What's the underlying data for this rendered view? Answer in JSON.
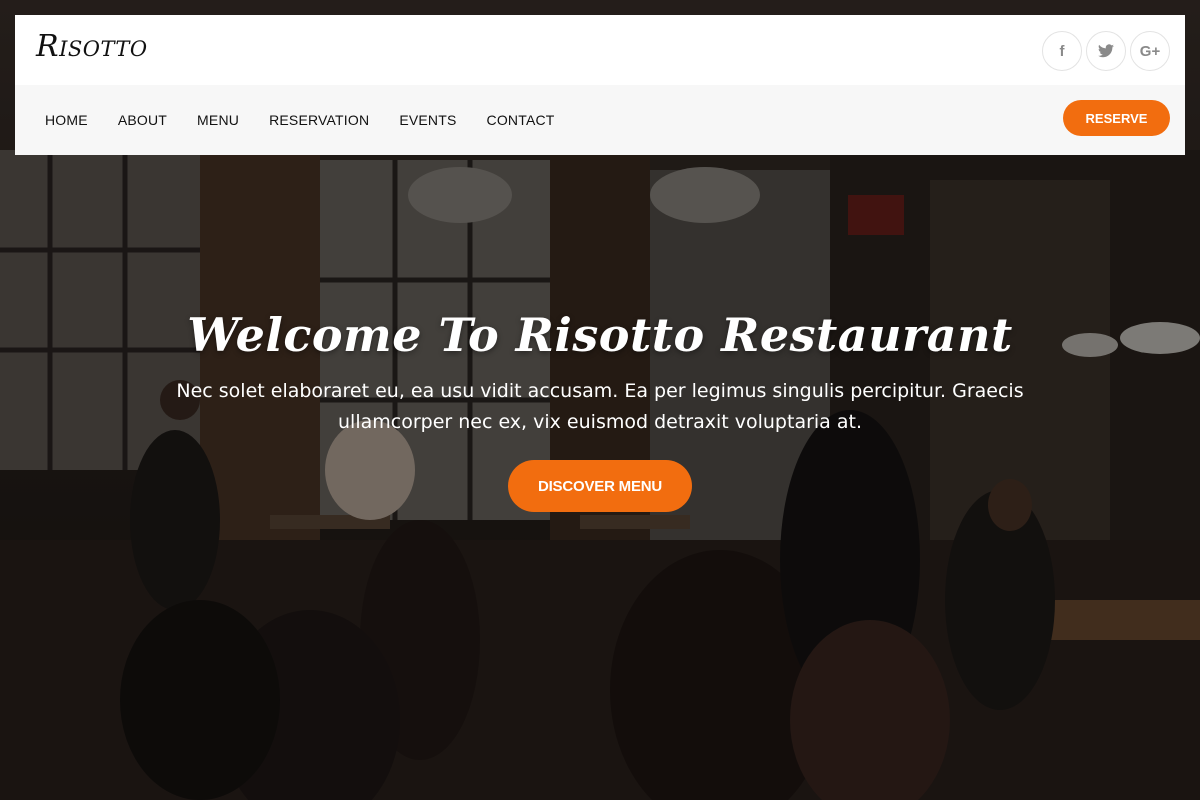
{
  "brand": {
    "logo": "Risotto"
  },
  "social": [
    {
      "icon": "facebook-icon",
      "glyph": "f"
    },
    {
      "icon": "twitter-icon",
      "glyph": "t"
    },
    {
      "icon": "google-plus-icon",
      "glyph": "G+"
    }
  ],
  "nav": {
    "items": [
      "HOME",
      "ABOUT",
      "MENU",
      "RESERVATION",
      "EVENTS",
      "CONTACT"
    ],
    "reserve_label": "RESERVE"
  },
  "hero": {
    "title": "Welcome To Risotto Restaurant",
    "text": "Nec solet elaboraret eu, ea usu vidit accusam. Ea per legimus singulis percipitur. Graecis ullamcorper nec ex, vix euismod detraxit voluptaria at.",
    "button_label": "DISCOVER MENU"
  },
  "colors": {
    "accent": "#f26d0f",
    "header_bg": "#ffffff",
    "nav_bg": "#f7f7f7",
    "text_dark": "#111111"
  }
}
